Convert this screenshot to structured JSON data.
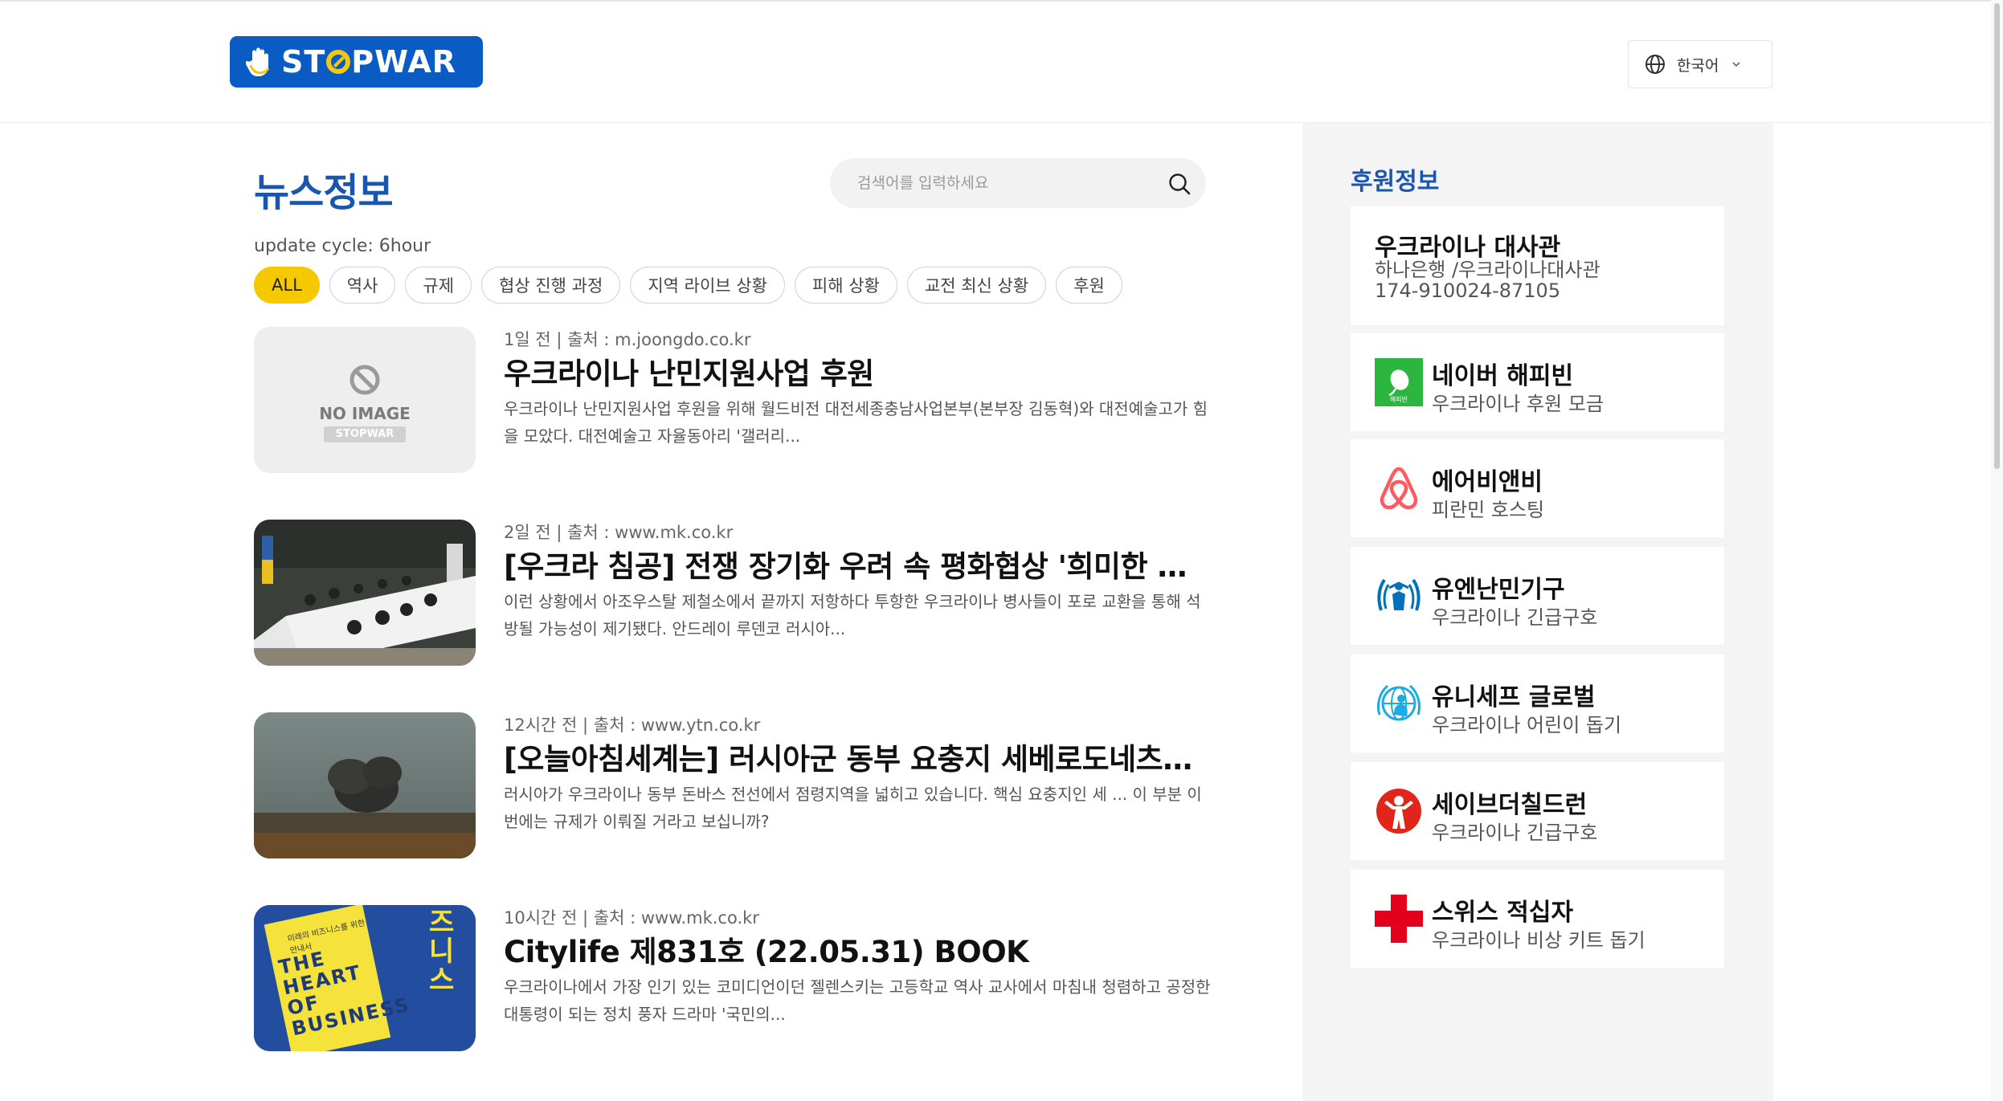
{
  "header": {
    "logo_text_pre": "ST",
    "logo_text_post": "PWAR",
    "language": "한국어"
  },
  "main": {
    "title": "뉴스정보",
    "search_placeholder": "검색어를 입력하세요",
    "update_cycle": "update cycle: 6hour",
    "tags": [
      "ALL",
      "역사",
      "규제",
      "협상 진행 과정",
      "지역 라이브 상황",
      "피해 상황",
      "교전 최신 상황",
      "후원"
    ],
    "news": [
      {
        "meta": "1일 전 | 출처 : m.joongdo.co.kr",
        "headline": "우크라이나 난민지원사업 후원",
        "snippet": "우크라이나 난민지원사업 후원을 위해 월드비전 대전세종충남사업본부(본부장 김동혁)와 대전예술고가 힘을 모았다. 대전예술고 자율동아리 '갤러리...",
        "noimage_label": "NO IMAGE",
        "noimage_logo": "STOPWAR"
      },
      {
        "meta": "2일 전 | 출처 : www.mk.co.kr",
        "headline": "[우크라 침공] 전쟁 장기화 우려 속 평화협상 '희미한 희망'",
        "snippet": "이런 상황에서 아조우스탈 제철소에서 끝까지 저항하다 투항한 우크라이나 병사들이 포로 교환을 통해 석방될 가능성이 제기됐다. 안드레이 루덴코 러시아..."
      },
      {
        "meta": "12시간 전 | 출처 : www.ytn.co.kr",
        "headline": "[오늘아침세계는] 러시아군 동부 요충지 세베로도네츠크…",
        "snippet": "러시아가 우크라이나 동부 돈바스 전선에서 점령지역을 넓히고 있습니다. 핵심 요충지인 세 ... 이 부분 이번에는 규제가 이뤄질 거라고 보십니까?"
      },
      {
        "meta": "10시간 전 | 출처 : www.mk.co.kr",
        "headline": "Citylife 제831호 (22.05.31) BOOK",
        "snippet": "우크라이나에서 가장 인기 있는 코미디언이던 젤렌스키는 고등학교 역사 교사에서 마침내 청렴하고 공정한 대통령이 되는 정치 풍자 드라마 '국민의...",
        "book_cover_small": "미래의 비즈니스를 위한 안내서",
        "book_cover_title": "THE HEART OF BUSINESS",
        "book_cover_side": "즈니스"
      }
    ]
  },
  "sidebar": {
    "title": "후원정보",
    "donors": [
      {
        "name": "우크라이나 대사관",
        "sub": "하나은행 /우크라이나대사관",
        "sub2": "174-910024-87105",
        "icon": "none"
      },
      {
        "name": "네이버 해피빈",
        "sub": "우크라이나 후원 모금",
        "icon": "happybean-icon",
        "icon_text": "해피빈"
      },
      {
        "name": "에어비앤비",
        "sub": "피란민 호스팅",
        "icon": "airbnb-icon"
      },
      {
        "name": "유엔난민기구",
        "sub": "우크라이나 긴급구호",
        "icon": "unhcr-icon"
      },
      {
        "name": "유니세프 글로벌",
        "sub": "우크라이나 어린이 돕기",
        "icon": "unicef-icon"
      },
      {
        "name": "세이브더칠드런",
        "sub": "우크라이나 긴급구호",
        "icon": "save-the-children-icon"
      },
      {
        "name": "스위스 적십자",
        "sub": "우크라이나 비상 키트 돕기",
        "icon": "red-cross-icon"
      }
    ]
  },
  "colors": {
    "brand_blue": "#1a56b0",
    "logo_blue": "#0a5bc4",
    "accent_yellow": "#f6c800",
    "sidebar_bg": "#f4f4f4",
    "happybean_green": "#2cb640",
    "airbnb_red": "#ff5a5f",
    "unhcr_blue": "#0072bc",
    "unicef_blue": "#1cabe2",
    "save_red": "#e1251b",
    "red_cross": "#e2001a"
  }
}
